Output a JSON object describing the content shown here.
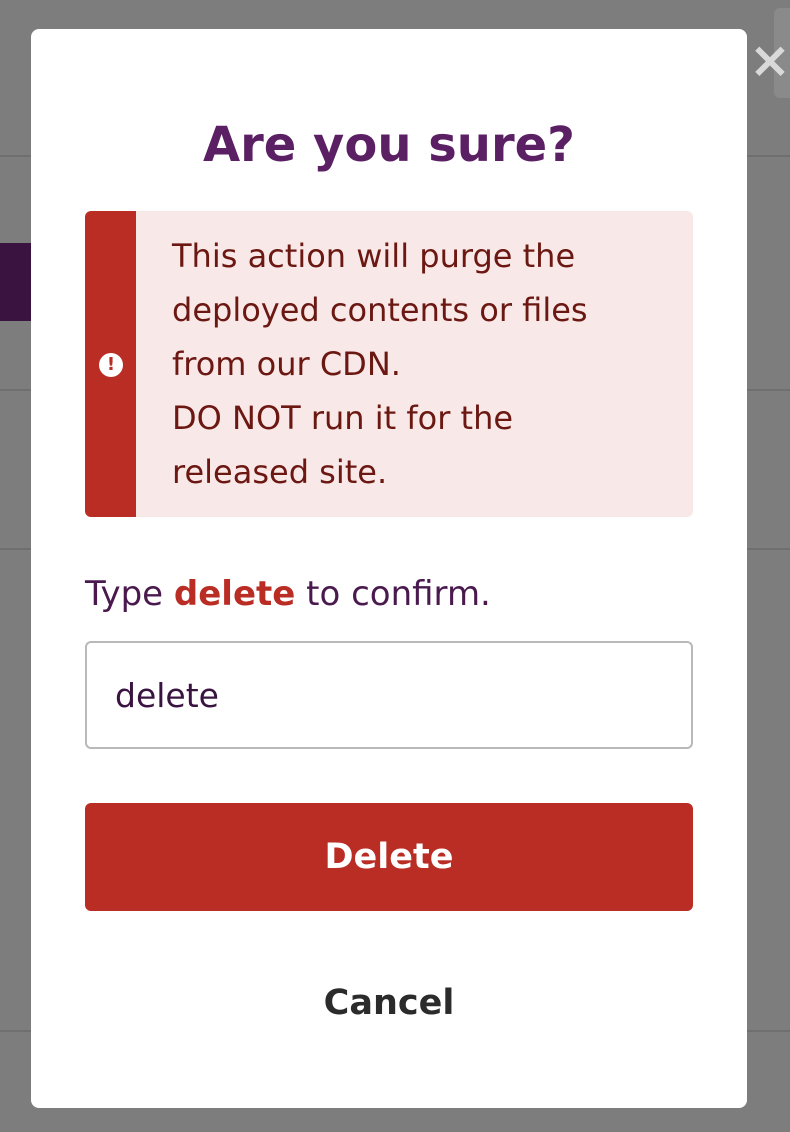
{
  "modal": {
    "title": "Are you sure?",
    "alert": {
      "icon": "exclamation-circle-icon",
      "message": "This action will purge the\ndeployed contents or files\nfrom our CDN.\nDO NOT run it for the\nreleased site."
    },
    "confirm": {
      "prefix": "Type",
      "keyword": "delete",
      "suffix": "to confirm.",
      "input_value": "delete"
    },
    "delete_label": "Delete",
    "cancel_label": "Cancel"
  },
  "close_icon": "close-icon",
  "colors": {
    "title": "#5b1f63",
    "danger": "#ba2d25",
    "alert_bg": "#f9e8e8",
    "overlay": "#7d7d7d"
  }
}
